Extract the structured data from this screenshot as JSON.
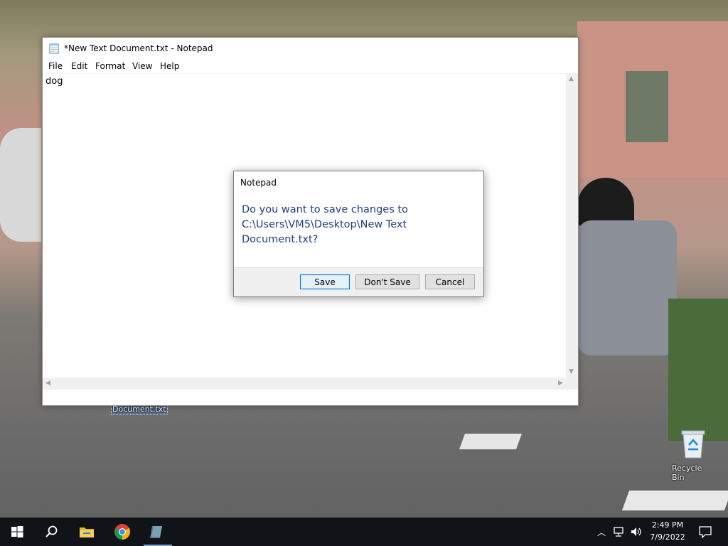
{
  "desktop": {
    "partial_file_label": "Document.txt",
    "recycle_bin_label": "Recycle Bin"
  },
  "notepad": {
    "title": "*New Text Document.txt - Notepad",
    "menu": [
      "File",
      "Edit",
      "Format",
      "View",
      "Help"
    ],
    "content": "dog"
  },
  "dialog": {
    "title": "Notepad",
    "message": "Do you want to save changes to C:\\Users\\VM5\\Desktop\\New Text Document.txt?",
    "save_label": "Save",
    "dont_save_label": "Don't Save",
    "cancel_label": "Cancel"
  },
  "taskbar": {
    "icons": [
      "windows-start-icon",
      "search-icon",
      "file-explorer-icon",
      "chrome-icon",
      "notepad-icon"
    ],
    "time": "2:49 PM",
    "date": "7/9/2022"
  },
  "colors": {
    "taskbar_bg": "#101418",
    "dialog_message": "#1f3c88",
    "default_button_border": "#0078d7"
  }
}
